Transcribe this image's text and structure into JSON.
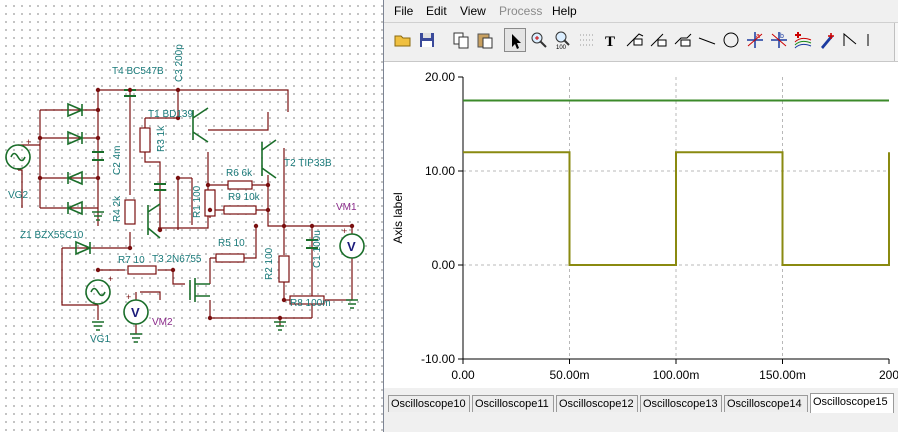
{
  "schematic": {
    "labels": {
      "t4": "T4 BC547B",
      "c3": "C3 200p",
      "t1": "T1 BD139",
      "r3": "R3 1k",
      "c2": "C2 4m",
      "t2": "T2 TIP33B",
      "r6": "R6 6k",
      "r9": "R9 10k",
      "r1": "R1 100",
      "vg2": "VG2",
      "r4": "R4 2k",
      "z1": "Z1 BZX55C10",
      "vm1": "VM1",
      "r5": "R5 10",
      "c1": "C1 100u",
      "r7": "R7 10",
      "t3": "T3 2N6755",
      "r2": "R2 100",
      "r8": "R8 100m",
      "vm2": "VM2",
      "vg1": "VG1"
    },
    "meter_symbol": "V",
    "plus_sign": "+"
  },
  "window": {
    "menu": [
      "File",
      "Edit",
      "View",
      "Process",
      "Help"
    ],
    "menu_disabled": [
      "Process"
    ],
    "toolbar_icons": [
      "open-folder-icon",
      "save-icon",
      "copy-icon",
      "paste-icon",
      "pointer-icon",
      "zoom-in-icon",
      "zoom-100-icon",
      "grid-select-icon",
      "text-icon",
      "curve-label-icon",
      "curve-label-2-icon",
      "curve-label-3-icon",
      "line-icon",
      "circle-icon",
      "cursor-a-icon",
      "cursor-b-icon",
      "curves-plus-icon",
      "pen-icon",
      "step-icon"
    ],
    "tabs": [
      "Oscilloscope10",
      "Oscilloscope11",
      "Oscilloscope12",
      "Oscilloscope13",
      "Oscilloscope14",
      "Oscilloscope15"
    ],
    "active_tab": "Oscilloscope15"
  },
  "chart_data": {
    "type": "line",
    "ylabel": "Axis label",
    "xlabel": "",
    "x_ticks": [
      "0.00",
      "50.00m",
      "100.00m",
      "150.00m",
      "200"
    ],
    "y_ticks": [
      "20.00",
      "10.00",
      "0.00",
      "-10.00"
    ],
    "xlim": [
      0,
      0.2
    ],
    "ylim": [
      -10,
      20
    ],
    "grid": true,
    "series": [
      {
        "color": "#3b8a2a",
        "x": [
          0,
          0.2
        ],
        "y": [
          17.5,
          17.5
        ]
      },
      {
        "color": "#8a8a10",
        "x": [
          0,
          0.05,
          0.05,
          0.1,
          0.1,
          0.15,
          0.15,
          0.2,
          0.2
        ],
        "y": [
          12,
          12,
          0,
          0,
          12,
          12,
          0,
          0,
          12
        ]
      }
    ]
  }
}
